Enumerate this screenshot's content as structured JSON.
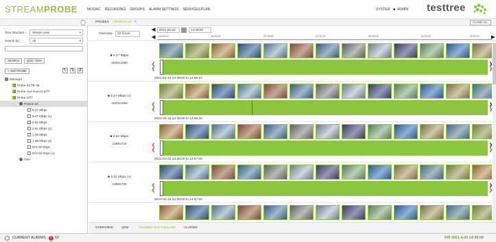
{
  "header": {
    "logo_stream": "STREAM",
    "logo_probe": "PROBE",
    "nav": [
      "MOSAIC",
      "RECORDING",
      "GROUPS",
      "ALARM SETTINGS",
      "SERVICES PLAN"
    ],
    "system_label": "SYSTEM",
    "admin_label": "ADMIN",
    "brand": "testtree",
    "accent_color": "#8cc63f"
  },
  "left_panel": {
    "tree_structure_label": "Tree structure :",
    "tree_structure_value": "Stream view",
    "search_by_label": "Search by :",
    "search_by_value": "All",
    "search_button": "SEARCH",
    "qoe_qos_button": "QOE / QOS",
    "add_probe_button": "+ ADD PROBE",
    "tree": [
      {
        "label": "Manager",
        "level": 0,
        "icon": "manager-icon"
      },
      {
        "label": "Probe SCTE-35",
        "level": 1,
        "icon": "probe-icon"
      },
      {
        "label": "Probe Live French DTT",
        "level": 1,
        "icon": "probe-icon"
      },
      {
        "label": "Probe OTT",
        "level": 1,
        "icon": "probe-icon"
      },
      {
        "label": "France 24",
        "level": 2,
        "icon": "channel-icon",
        "selected": true
      },
      {
        "label": "5.27 Mbps",
        "level": 3,
        "icon": "monitor-icon"
      },
      {
        "label": "5.27 Mbps (1)",
        "level": 3,
        "icon": "monitor-icon"
      },
      {
        "label": "2.51 Mbps",
        "level": 3,
        "icon": "monitor-icon"
      },
      {
        "label": "2.51 Mbps (1)",
        "level": 3,
        "icon": "monitor-icon"
      },
      {
        "label": "1.08 Mbps",
        "level": 3,
        "icon": "monitor-icon"
      },
      {
        "label": "1.08 Mbps (1)",
        "level": 3,
        "icon": "monitor-icon"
      },
      {
        "label": "673.02 Kbps",
        "level": 3,
        "icon": "monitor-icon"
      },
      {
        "label": "673.02 Kbps (1)",
        "level": 3,
        "icon": "monitor-icon"
      },
      {
        "label": "mire",
        "level": 2,
        "icon": "channel-icon"
      }
    ]
  },
  "tabs": {
    "probes": "PROBES",
    "active": "FRANCE 24",
    "close_all": "CLOSE ALL"
  },
  "toolbar": {
    "overview_label": "Overview",
    "overview_value": "24 hours",
    "date": "2021-04-23",
    "time": "14:39:00",
    "ruler_ticks": [
      "14:39:00",
      "18:39:00",
      "22:39:00",
      "02:39:00",
      "06:39:00",
      "10:39:00",
      "14:39:00"
    ]
  },
  "rows": [
    {
      "bitrate": "5.27 Mbps",
      "resolution": "1920x1080",
      "range": "2021-04-22 14:39:00 to 14:56:57"
    },
    {
      "bitrate": "5.27 Mbps (1)",
      "resolution": "1920x1080",
      "range": "2021-04-22 14:39:00 to 14:56:32",
      "red_mark": 0.28
    },
    {
      "bitrate": "2.51 Mbps",
      "resolution": "1280x720",
      "range": "2021-04-22 14:39:00 to 14:57:00"
    },
    {
      "bitrate": "2.51 Mbps (1)",
      "resolution": "1280x720",
      "range": "2021-04-22 14:39:00 to 14:57:00"
    }
  ],
  "bottom_tabs": [
    "OVERVIEW",
    "QOE",
    "THUMBNAILS TIMELINE",
    "ALARMS"
  ],
  "bottom_active": "THUMBNAILS TIMELINE",
  "status": {
    "current_alarms_label": "CURRENT ALARMS -",
    "alarm_icon": "!",
    "count": "52",
    "datetime": "FRI 2021-4-23 14:39:09"
  }
}
